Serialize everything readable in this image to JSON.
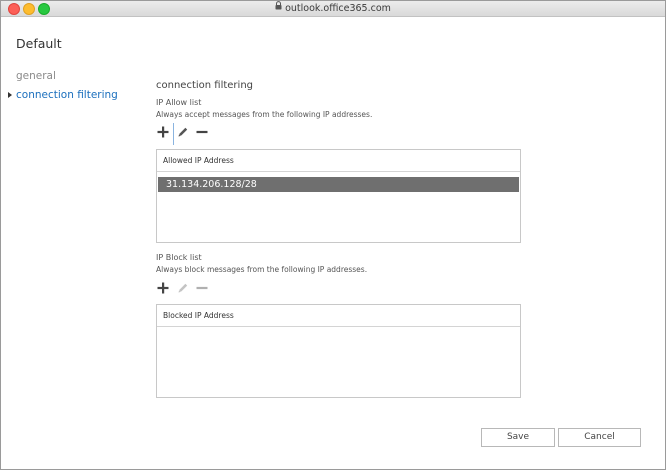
{
  "browser": {
    "url": "outlook.office365.com"
  },
  "page": {
    "title": "Default"
  },
  "nav": {
    "items": [
      {
        "label": "general"
      },
      {
        "label": "connection filtering"
      }
    ]
  },
  "main": {
    "section_title": "connection filtering",
    "allow": {
      "label": "IP Allow list",
      "description": "Always accept messages from the following IP addresses.",
      "column_header": "Allowed IP Address",
      "rows": [
        "31.134.206.128/28"
      ],
      "selected_row": 0
    },
    "block": {
      "label": "IP Block list",
      "description": "Always block messages from the following IP addresses.",
      "column_header": "Blocked IP Address",
      "rows": []
    }
  },
  "actions": {
    "save_label": "Save",
    "cancel_label": "Cancel"
  },
  "icons": {
    "toolbar": [
      "plus-icon",
      "pencil-icon",
      "minus-icon"
    ]
  }
}
